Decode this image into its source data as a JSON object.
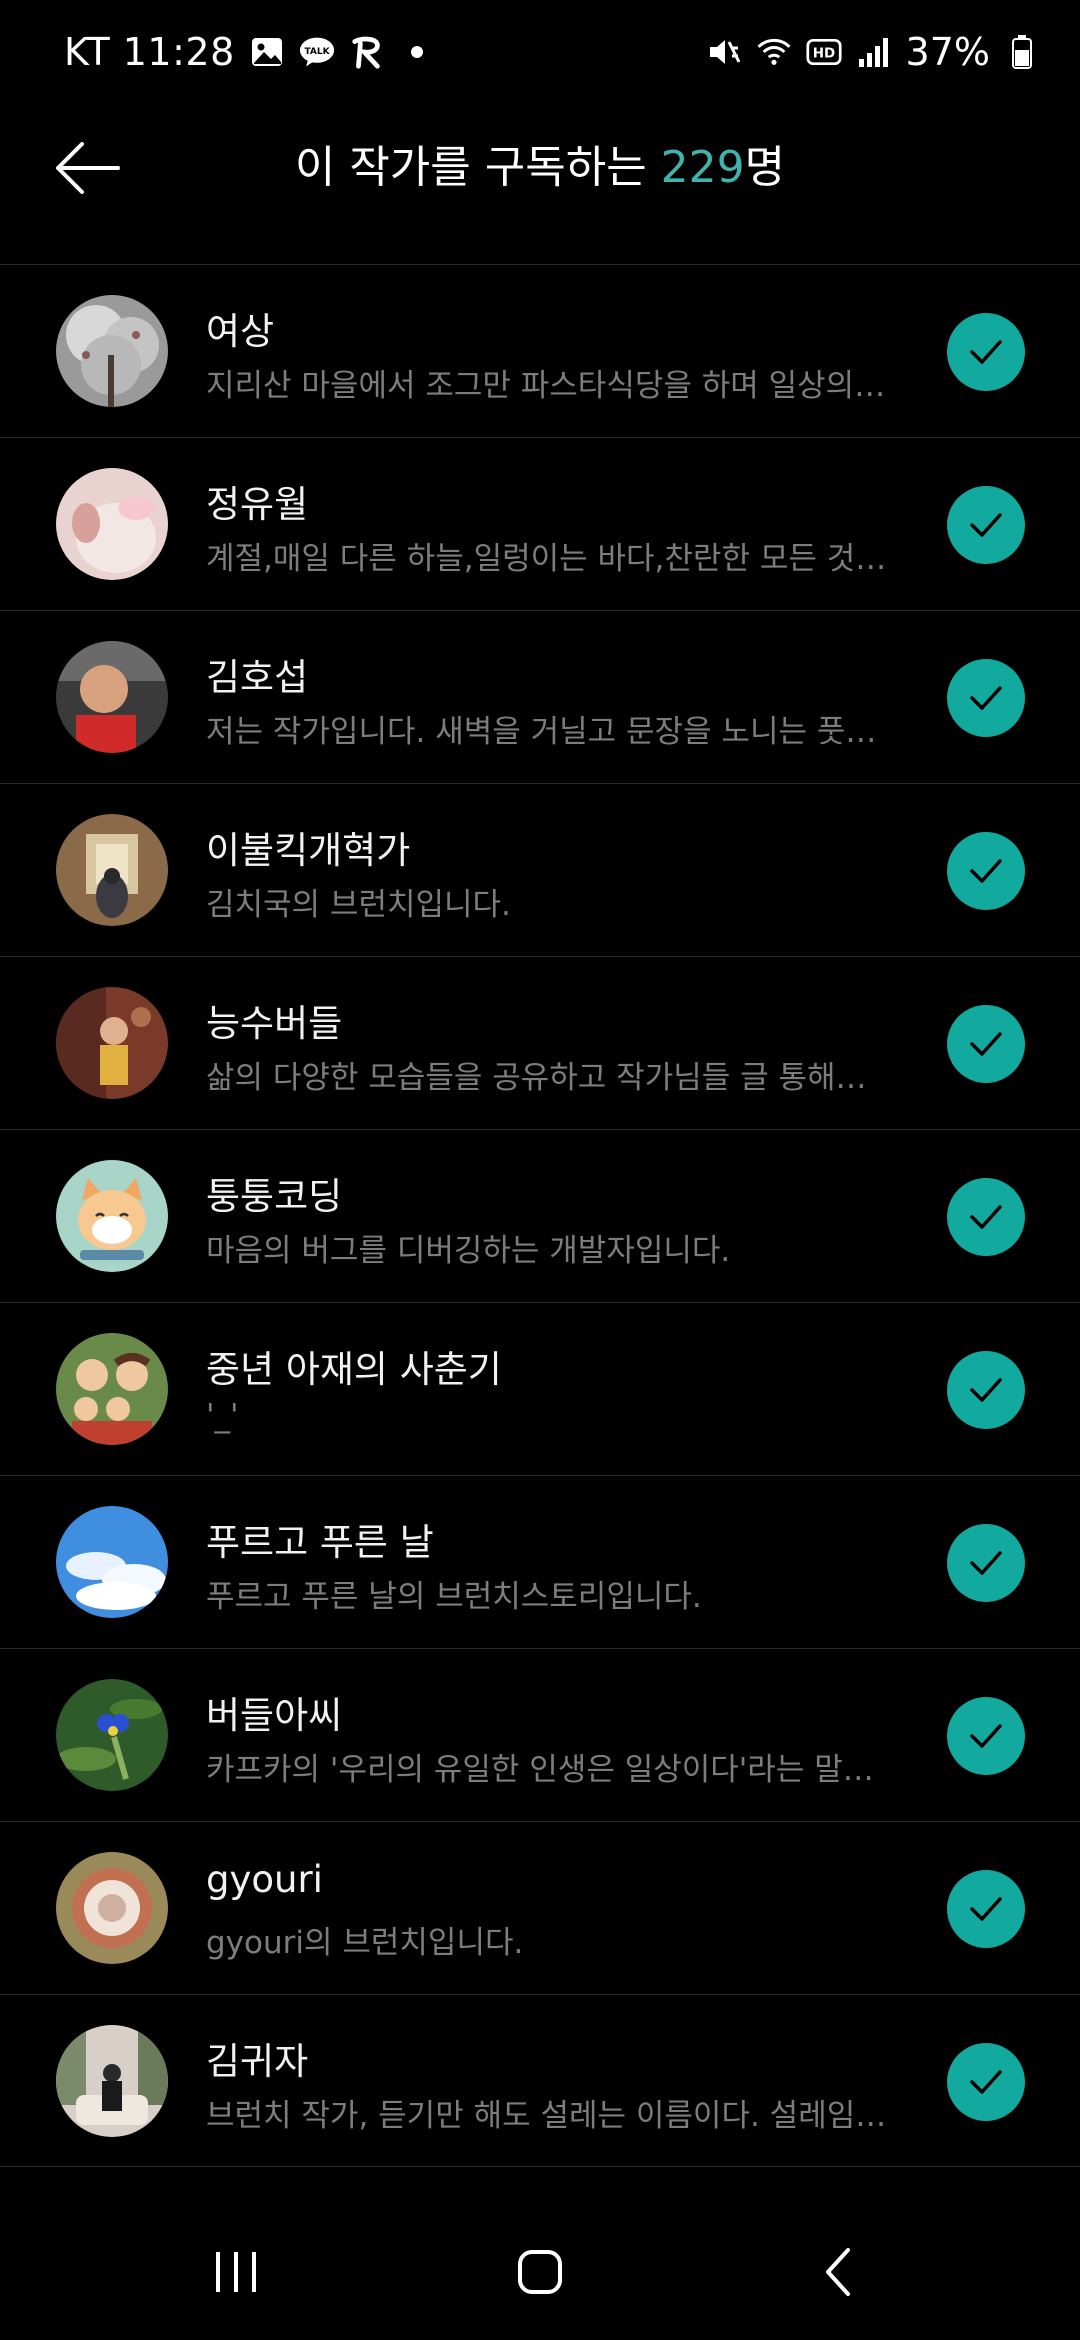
{
  "status_bar": {
    "carrier_time": "KT 11:28",
    "battery": "37%",
    "icons_left": [
      "gallery-icon",
      "kakaotalk-icon",
      "app-r-icon",
      "dot-icon"
    ],
    "icons_right": [
      "mute-icon",
      "wifi-icon",
      "hd-icon",
      "signal-icon",
      "battery-icon"
    ],
    "talk_label": "TALK",
    "hd_label": "HD"
  },
  "header": {
    "title_prefix": "이 작가를 구독하는 ",
    "count": "229",
    "title_suffix": "명",
    "accent": "#3fb3ad"
  },
  "colors": {
    "background": "#000000",
    "check_bg": "#12a99f",
    "desc": "#7d7d7d"
  },
  "subscribers": [
    {
      "name": "여상",
      "desc": "지리산 마을에서 조그만 파스타식당을 하며 일상의…",
      "subscribed": true
    },
    {
      "name": "정유월",
      "desc": "계절,매일 다른 하늘,일렁이는 바다,찬란한 모든 것…",
      "subscribed": true
    },
    {
      "name": "김호섭",
      "desc": "저는 작가입니다. 새벽을 거닐고 문장을 노니는 풋…",
      "subscribed": true
    },
    {
      "name": "이불킥개혁가",
      "desc": "김치국의 브런치입니다.",
      "subscribed": true
    },
    {
      "name": "능수버들",
      "desc": "삶의 다양한 모습들을 공유하고 작가님들 글 통해…",
      "subscribed": true
    },
    {
      "name": "퉁퉁코딩",
      "desc": "마음의 버그를 디버깅하는 개발자입니다.",
      "subscribed": true
    },
    {
      "name": "중년 아재의 사춘기",
      "desc": "'_'",
      "subscribed": true
    },
    {
      "name": "푸르고 푸른 날",
      "desc": "푸르고 푸른 날의 브런치스토리입니다.",
      "subscribed": true
    },
    {
      "name": "버들아씨",
      "desc": "카프카의 '우리의 유일한 인생은 일상이다'라는 말…",
      "subscribed": true
    },
    {
      "name": "gyouri",
      "desc": "gyouri의 브런치입니다.",
      "subscribed": true
    },
    {
      "name": "김귀자",
      "desc": "브런치 작가, 듣기만 해도 설레는 이름이다. 설레임…",
      "subscribed": true
    }
  ],
  "nav": [
    "recents-icon",
    "home-icon",
    "back-icon"
  ]
}
